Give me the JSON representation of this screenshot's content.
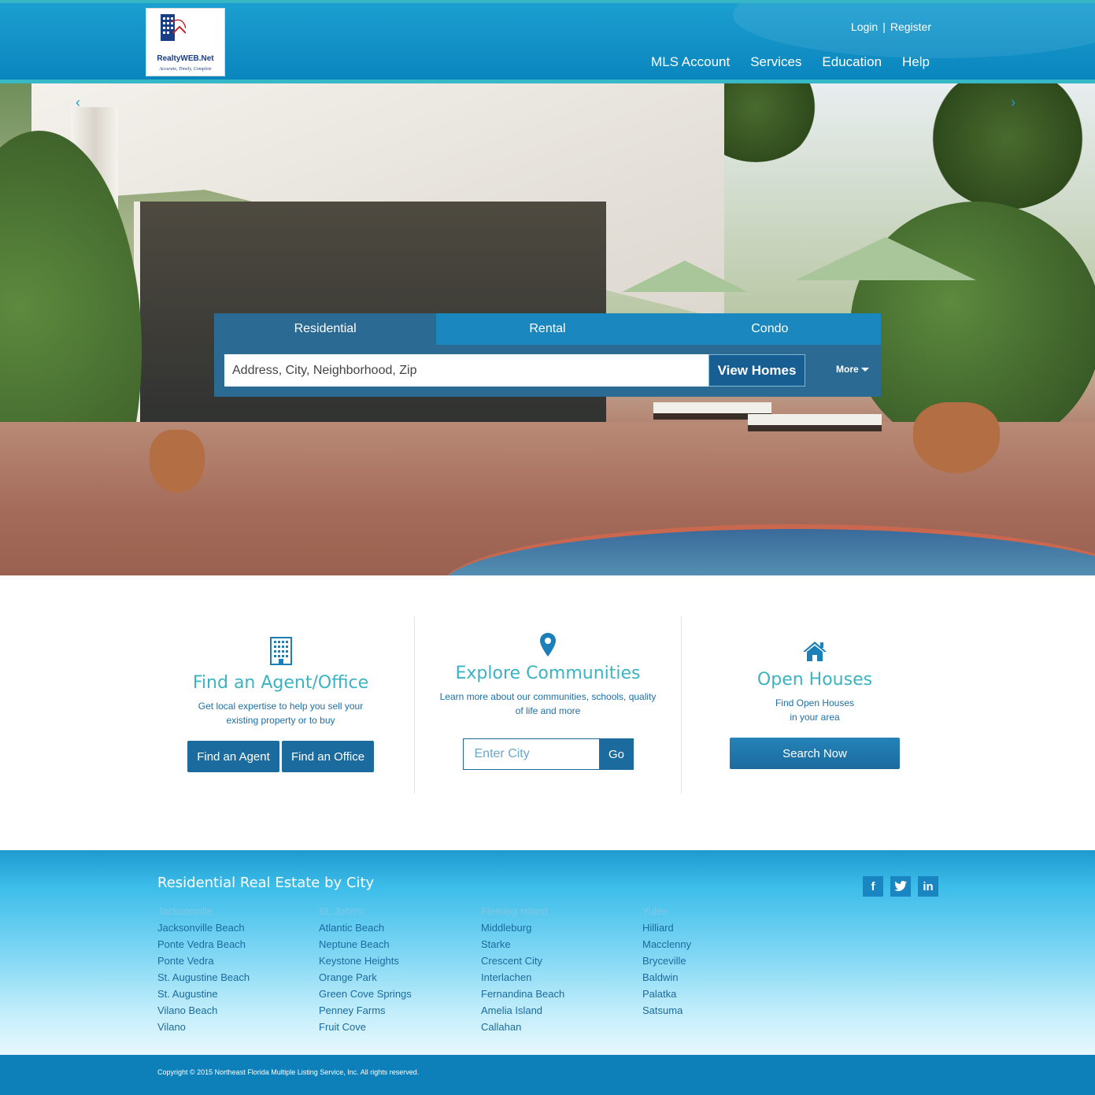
{
  "header": {
    "logo_brand": "RealtyWEB.Net",
    "logo_tagline": "Accurate, Timely, Complete",
    "login": "Login",
    "separator": "|",
    "register": "Register",
    "nav": [
      "MLS Account",
      "Services",
      "Education",
      "Help"
    ]
  },
  "search": {
    "tabs": [
      "Residential",
      "Rental",
      "Condo"
    ],
    "active_tab": "Residential",
    "placeholder": "Address, City, Neighborhood, Zip",
    "button": "View Homes",
    "more": "More"
  },
  "features": {
    "agent": {
      "title": "Find an Agent/Office",
      "desc_line1": "Get local expertise to help you sell your",
      "desc_line2": "existing property or to buy",
      "btn_agent": "Find an Agent",
      "btn_office": "Find an Office"
    },
    "communities": {
      "title": "Explore Communities",
      "desc_line1": "Learn more about our communities, schools, quality",
      "desc_line2": "of life and more",
      "placeholder": "Enter City",
      "go": "Go"
    },
    "open_houses": {
      "title": "Open Houses",
      "desc_line1": "Find Open Houses",
      "desc_line2": "in your area",
      "button": "Search Now"
    }
  },
  "cities": {
    "heading": "Residential Real Estate by City",
    "columns": [
      [
        "Jacksonville",
        "Jacksonville Beach",
        "Ponte Vedra Beach",
        "Ponte Vedra",
        "St. Augustine Beach",
        "St. Augustine",
        "Vilano Beach",
        "Vilano"
      ],
      [
        "St. John's",
        "Atlantic Beach",
        "Neptune Beach",
        "Keystone Heights",
        "Orange Park",
        "Green Cove Springs",
        "Penney Farms",
        "Fruit Cove"
      ],
      [
        "Fleming Island",
        "Middleburg",
        "Starke",
        "Crescent City",
        "Interlachen",
        "Fernandina Beach",
        "Amelia Island",
        "Callahan"
      ],
      [
        "Yulee",
        "Hilliard",
        "Macclenny",
        "Bryceville",
        "Baldwin",
        "Palatka",
        "Satsuma"
      ]
    ],
    "social": [
      "f",
      "t",
      "in"
    ]
  },
  "footer": {
    "copyright": "Copyright © 2015 Northeast Florida Multiple Listing Service, Inc. All rights reserved."
  },
  "colors": {
    "primary": "#1a87be",
    "accent": "#3bb3c2",
    "dark_button": "#1b6b9e"
  }
}
